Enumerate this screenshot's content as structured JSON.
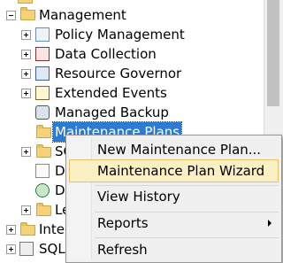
{
  "tree": {
    "management_label": "Management",
    "items": [
      {
        "label": "Policy Management",
        "icon": "policy-icon"
      },
      {
        "label": "Data Collection",
        "icon": "data-collection-icon"
      },
      {
        "label": "Resource Governor",
        "icon": "resource-governor-icon"
      },
      {
        "label": "Extended Events",
        "icon": "extended-events-icon"
      },
      {
        "label": "Managed Backup",
        "icon": "managed-backup-icon"
      },
      {
        "label": "Maintenance Plans",
        "icon": "folder-icon"
      },
      {
        "label": "SQ",
        "icon": "folder-icon"
      },
      {
        "label": "D",
        "icon": "database-mail-icon"
      },
      {
        "label": "D",
        "icon": "dtc-icon"
      },
      {
        "label": "Le",
        "icon": "folder-icon"
      }
    ],
    "bottom_items": [
      {
        "label": "Integ"
      },
      {
        "label": "SQL"
      }
    ]
  },
  "context_menu": {
    "items": [
      {
        "label": "New Maintenance Plan..."
      },
      {
        "label": "Maintenance Plan Wizard"
      },
      {
        "label": "View History"
      },
      {
        "label": "Reports"
      },
      {
        "label": "Refresh"
      }
    ]
  },
  "colors": {
    "selection": "#2b7bd4",
    "hover": "#fbefc4"
  }
}
